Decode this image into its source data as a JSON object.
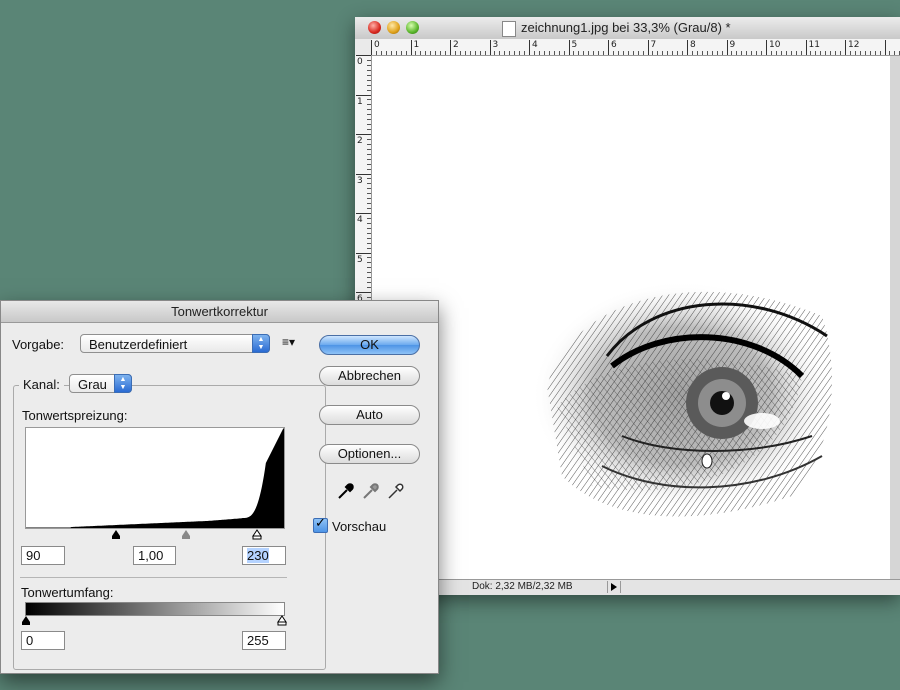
{
  "document": {
    "title": "zeichnung1.jpg bei 33,3% (Grau/8) *",
    "status": "Dok: 2,32 MB/2,32 MB",
    "ruler_top_labels": [
      "0",
      "1",
      "2",
      "3",
      "4",
      "5",
      "6",
      "7",
      "8",
      "9",
      "10",
      "11",
      "12"
    ],
    "ruler_left_labels": [
      "0",
      "1",
      "2",
      "3",
      "4",
      "5",
      "6"
    ]
  },
  "dialog": {
    "title": "Tonwertkorrektur",
    "preset_label": "Vorgabe:",
    "preset_value": "Benutzerdefiniert",
    "channel_label": "Kanal:",
    "channel_value": "Grau",
    "input_levels_label": "Tonwertspreizung:",
    "input_black": "90",
    "input_gamma": "1,00",
    "input_white": "230",
    "output_levels_label": "Tonwertumfang:",
    "output_black": "0",
    "output_white": "255",
    "buttons": {
      "ok": "OK",
      "cancel": "Abbrechen",
      "auto": "Auto",
      "options": "Optionen..."
    },
    "preview_label": "Vorschau",
    "preview_checked": true
  },
  "histogram": {
    "bins_0_to_255": 256
  },
  "colors": {
    "desktop": "#5a8576",
    "accent": "#4e94e6"
  }
}
